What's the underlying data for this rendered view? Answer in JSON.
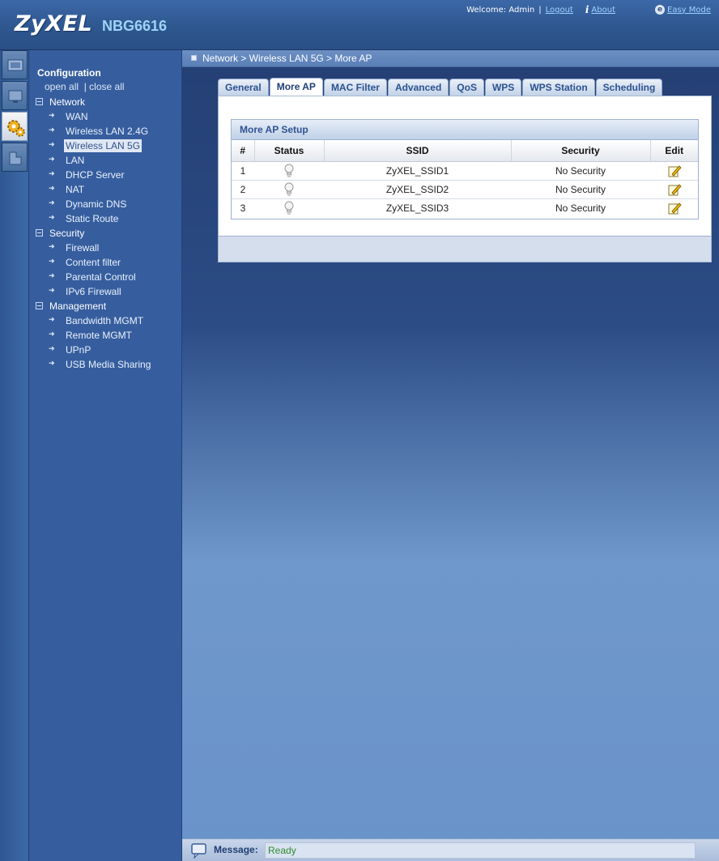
{
  "header": {
    "brand": "ZyXEL",
    "model": "NBG6616",
    "welcome_text": "Welcome: Admin",
    "logout_label": "Logout",
    "about_label": "About",
    "easy_mode_label": "Easy Mode"
  },
  "rail": {
    "items": [
      {
        "name": "status-icon",
        "active": false
      },
      {
        "name": "monitor-icon",
        "active": false
      },
      {
        "name": "configuration-gear-icon",
        "active": true
      },
      {
        "name": "maintenance-icon",
        "active": false
      }
    ]
  },
  "sidebar": {
    "title": "Configuration",
    "open_all": "open all",
    "close_all": "close all",
    "groups": [
      {
        "label": "Network",
        "items": [
          "WAN",
          "Wireless LAN 2.4G",
          "Wireless LAN 5G",
          "LAN",
          "DHCP Server",
          "NAT",
          "Dynamic DNS",
          "Static Route"
        ]
      },
      {
        "label": "Security",
        "items": [
          "Firewall",
          "Content filter",
          "Parental Control",
          "IPv6 Firewall"
        ]
      },
      {
        "label": "Management",
        "items": [
          "Bandwidth MGMT",
          "Remote MGMT",
          "UPnP",
          "USB Media Sharing"
        ]
      }
    ],
    "selected_item": "Wireless LAN 5G"
  },
  "breadcrumb": "Network > Wireless LAN 5G > More AP",
  "tabs": [
    "General",
    "More AP",
    "MAC Filter",
    "Advanced",
    "QoS",
    "WPS",
    "WPS Station",
    "Scheduling"
  ],
  "active_tab": "More AP",
  "section": {
    "title": "More AP Setup",
    "columns": [
      "#",
      "Status",
      "SSID",
      "Security",
      "Edit"
    ],
    "rows": [
      {
        "num": "1",
        "status": "off",
        "ssid": "ZyXEL_SSID1",
        "security": "No Security"
      },
      {
        "num": "2",
        "status": "off",
        "ssid": "ZyXEL_SSID2",
        "security": "No Security"
      },
      {
        "num": "3",
        "status": "off",
        "ssid": "ZyXEL_SSID3",
        "security": "No Security"
      }
    ]
  },
  "statusbar": {
    "label": "Message:",
    "value": "Ready"
  },
  "colors": {
    "accent": "#365e9f",
    "ready_text": "#2e8b2e"
  }
}
